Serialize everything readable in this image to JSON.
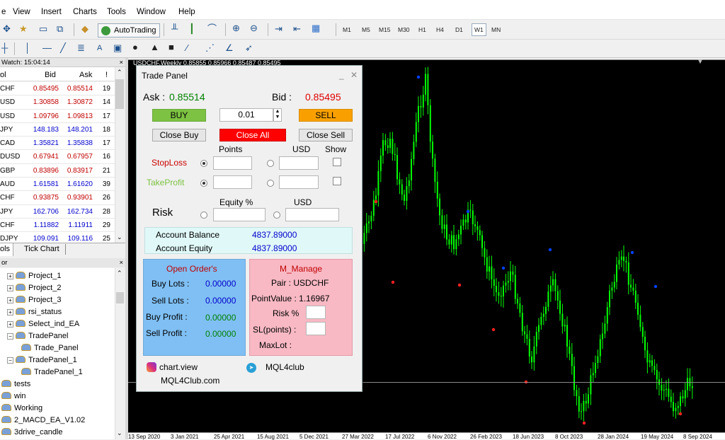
{
  "menu": [
    "e",
    "View",
    "Insert",
    "Charts",
    "Tools",
    "Window",
    "Help"
  ],
  "toolbar": {
    "autotrading_label": "AutoTrading",
    "timeframes": [
      "M1",
      "M5",
      "M15",
      "M30",
      "H1",
      "H4",
      "D1",
      "W1",
      "MN"
    ],
    "active_timeframe": "W1",
    "text_tool": "A"
  },
  "market_watch": {
    "title": "Watch: 15:04:14",
    "close": "×",
    "col_symbol": "ol",
    "col_bid": "Bid",
    "col_ask": "Ask",
    "col_spread": "!",
    "rows": [
      {
        "symbol": "CHF",
        "bid": "0.85495",
        "ask": "0.85514",
        "spread": "19",
        "dir": "red"
      },
      {
        "symbol": "USD",
        "bid": "1.30858",
        "ask": "1.30872",
        "spread": "14",
        "dir": "red"
      },
      {
        "symbol": "USD",
        "bid": "1.09796",
        "ask": "1.09813",
        "spread": "17",
        "dir": "red"
      },
      {
        "symbol": "JPY",
        "bid": "148.183",
        "ask": "148.201",
        "spread": "18",
        "dir": "blue"
      },
      {
        "symbol": "CAD",
        "bid": "1.35821",
        "ask": "1.35838",
        "spread": "17",
        "dir": "blue"
      },
      {
        "symbol": "DUSD",
        "bid": "0.67941",
        "ask": "0.67957",
        "spread": "16",
        "dir": "red"
      },
      {
        "symbol": "GBP",
        "bid": "0.83896",
        "ask": "0.83917",
        "spread": "21",
        "dir": "red"
      },
      {
        "symbol": "AUD",
        "bid": "1.61581",
        "ask": "1.61620",
        "spread": "39",
        "dir": "blue"
      },
      {
        "symbol": "CHF",
        "bid": "0.93875",
        "ask": "0.93901",
        "spread": "26",
        "dir": "red"
      },
      {
        "symbol": "JPY",
        "bid": "162.706",
        "ask": "162.734",
        "spread": "28",
        "dir": "blue"
      },
      {
        "symbol": "CHF",
        "bid": "1.11882",
        "ask": "1.11911",
        "spread": "29",
        "dir": "blue"
      },
      {
        "symbol": "DJPY",
        "bid": "109.091",
        "ask": "109.116",
        "spread": "25",
        "dir": "blue"
      }
    ],
    "tabs": [
      "ols",
      "Tick Chart"
    ]
  },
  "navigator": {
    "title": "or",
    "close": "×",
    "items": [
      "Project_1",
      "Project_2",
      "Project_3",
      "rsi_status",
      "Select_ind_EA",
      "TradePanel",
      "Trade_Panel",
      "TradePanel_1",
      "TradePanel_1",
      "tests",
      "win",
      "Working",
      "2_MACD_EA_V1.02",
      "3drive_candle"
    ]
  },
  "chart": {
    "title": "USDCHF,Weekly  0.85855 0.85966 0.85487 0.85495",
    "dates": [
      "13 Sep 2020",
      "3 Jan 2021",
      "25 Apr 2021",
      "15 Aug 2021",
      "5 Dec 2021",
      "27 Mar 2022",
      "17 Jul 2022",
      "6 Nov 2022",
      "26 Feb 2023",
      "18 Jun 2023",
      "8 Oct 2023",
      "28 Jan 2024",
      "19 May 2024",
      "8 Sep 2024"
    ],
    "candle_color": "#00ff00",
    "background": "#000000"
  },
  "trade_panel": {
    "title": "Trade Panel",
    "controls": "_ ✕",
    "ask_label": "Ask :",
    "ask_value": "0.85514",
    "bid_label": "Bid :",
    "bid_value": "0.85495",
    "buy": "BUY",
    "lot": "0.01",
    "sell": "SELL",
    "close_buy": "Close Buy",
    "close_all": "Close All",
    "close_sell": "Close Sell",
    "col_points": "Points",
    "col_usd": "USD",
    "col_show": "Show",
    "stoploss": "StopLoss",
    "takeprofit": "TakeProfit",
    "col_equity": "Equity %",
    "col_usd2": "USD",
    "risk": "Risk",
    "account_balance_label": "Account Balance",
    "account_balance": "4837.89000",
    "account_equity_label": "Account Equity",
    "account_equity": "4837.89000",
    "open_orders_title": "Open Order's",
    "buy_lots_label": "Buy Lots :",
    "buy_lots": "0.00000",
    "sell_lots_label": "Sell Lots :",
    "sell_lots": "0.00000",
    "buy_profit_label": "Buy Profit :",
    "buy_profit": "0.00000",
    "sell_profit_label": "Sell Profit :",
    "sell_profit": "0.00000",
    "manage_title": "M_Manage",
    "pair": "Pair : USDCHF",
    "pointvalue": "PointValue : 1.16967",
    "risk_pct_label": "Risk %",
    "sl_points_label": "SL(points) :",
    "maxlot_label": "MaxLot :",
    "link_chartview": "chart.view",
    "link_mql4club": "MQL4club",
    "link_site": "MQL4Club.com",
    "colors": {
      "buy": "#7dc242",
      "sell": "#f9a000",
      "close_all": "#ff0000",
      "ask": "#008000",
      "bid": "#e00000",
      "value_blue": "#0000cc"
    }
  }
}
